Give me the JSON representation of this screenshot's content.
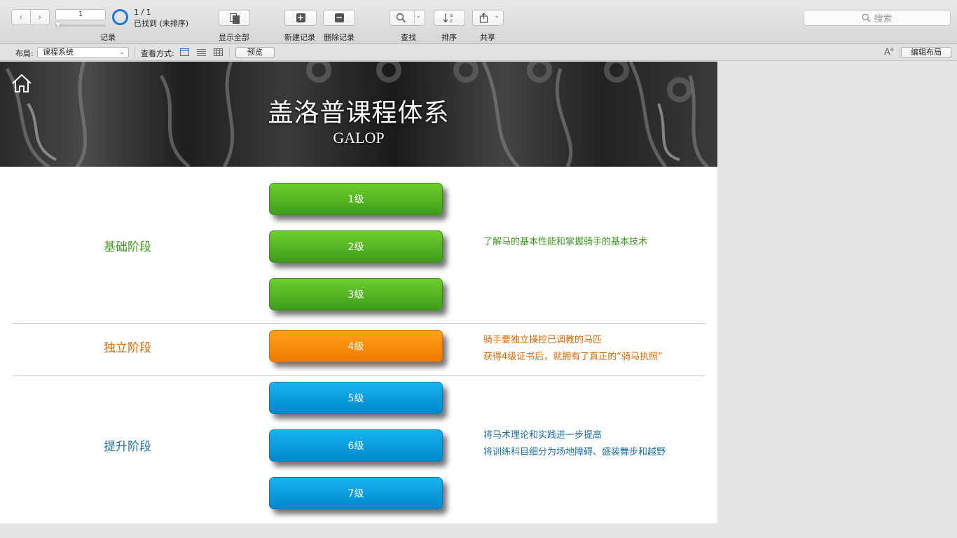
{
  "toolbar": {
    "record_number": "1",
    "record_label": "记录",
    "found_count": "1 / 1",
    "found_status": "已找到 (未排序)",
    "show_all": "显示全部",
    "new_record": "新建记录",
    "delete_record": "删除记录",
    "find": "查找",
    "sort": "排序",
    "share": "共享",
    "search_placeholder": "搜索"
  },
  "layout_bar": {
    "layout_label": "布局:",
    "layout_value": "课程系统",
    "view_as_label": "查看方式:",
    "preview": "预览",
    "edit_layout": "编辑布局"
  },
  "banner": {
    "title": "盖洛普课程体系",
    "subtitle": "GALOP"
  },
  "stages": [
    {
      "label": "基础阶段",
      "levels": [
        "1级",
        "2级",
        "3级"
      ],
      "desc": [
        "了解马的基本性能和掌握骑手的基本技术"
      ],
      "color": "#3e9a1e"
    },
    {
      "label": "独立阶段",
      "levels": [
        "4级"
      ],
      "desc": [
        "骑手要独立操控已调教的马匹",
        "获得4级证书后，就拥有了真正的“骑马执照”"
      ],
      "color": "#d96800"
    },
    {
      "label": "提升阶段",
      "levels": [
        "5级",
        "6级",
        "7级"
      ],
      "desc": [
        "将马术理论和实践进一步提高",
        "将训练科目细分为场地障碍、盛装舞步和越野"
      ],
      "color": "#1a6fa3"
    }
  ],
  "colors": {
    "accent_blue": "#1e74d8",
    "stage_green": "#3e9a1e",
    "stage_orange": "#d96800",
    "stage_blue": "#1a6fa3"
  }
}
